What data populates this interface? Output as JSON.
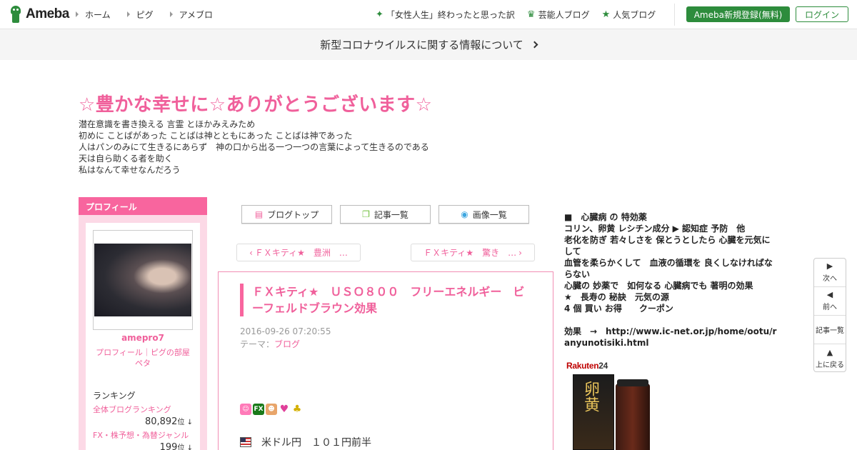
{
  "header": {
    "logo": "Ameba",
    "nav": [
      "ホーム",
      "ピグ",
      "アメブロ"
    ],
    "links": [
      "「女性人生」終わったと思った訳",
      "芸能人ブログ",
      "人気ブログ"
    ],
    "register": "Ameba新規登録(無料)",
    "login": "ログイン"
  },
  "banner": "新型コロナウイルスに関する情報について",
  "blog": {
    "title": "☆豊かな幸せに☆ありがとうございます☆",
    "description": [
      "潜在意識を書き換える 言霊 とほかみえみため",
      "初めに ことばがあった ことばは神とともにあった ことばは神であった",
      "人はパンのみにて生きるにあらず　神の口から出る一つ一つの言葉によって生きるのである",
      "天は自ら助くる者を助く",
      "私はなんて幸せなんだろう"
    ]
  },
  "profile": {
    "heading": "プロフィール",
    "name": "amepro7",
    "links": "プロフィール｜ピグの部屋",
    "peta": "ペタ",
    "ranking_heading": "ランキング",
    "rankings": [
      {
        "label": "全体ブログランキング",
        "value": "80,892",
        "unit": "位 ↓"
      },
      {
        "label": "FX・株予想・為替ジャンル",
        "value": "199",
        "unit": "位 ↓"
      }
    ]
  },
  "toolbar": {
    "blog_top": "ブログトップ",
    "entry_list": "記事一覧",
    "image_list": "画像一覧"
  },
  "pager": {
    "prev": "ＦＸキティ★　豊洲　…",
    "next": "ＦＸキティ★　驚き　…"
  },
  "entry": {
    "title": "ＦＸキティ★　ＵＳＯ８００　フリーエネルギー　ビーフェルドブラウン効果",
    "date": "2016-09-26 07:20:55",
    "theme_label": "テーマ：",
    "theme": "ブログ",
    "usd_line": "米ドル円　１０１円前半"
  },
  "sidebar_text": [
    "■　心臓病 の 特効薬",
    "コリン、卵黄 レシチン成分 ▶ 認知症 予防　他",
    "老化を防ぎ 若々しさを 保とうとしたら 心臓を元気にして",
    "血管を柔らかくして　血液の循環を 良くしなければならない",
    "心臓の 妙薬で　如何なる 心臓病でも 著明の効果",
    "★　長寿の 秘訣　元気の源",
    "4 個 買い お得　　クーポン",
    "",
    "効果　→　http://www.ic-net.or.jp/home/ootu/ranyunotisiki.html"
  ],
  "ad": {
    "brand": "Rakuten",
    "brand_num": "24",
    "product_kanji": "卵黄"
  },
  "side_nav": [
    {
      "arrow": "▶",
      "label": "次へ"
    },
    {
      "arrow": "◀",
      "label": "前へ"
    },
    {
      "arrow": "",
      "label": "記事一覧"
    },
    {
      "arrow": "▲",
      "label": "上に戻る"
    }
  ]
}
